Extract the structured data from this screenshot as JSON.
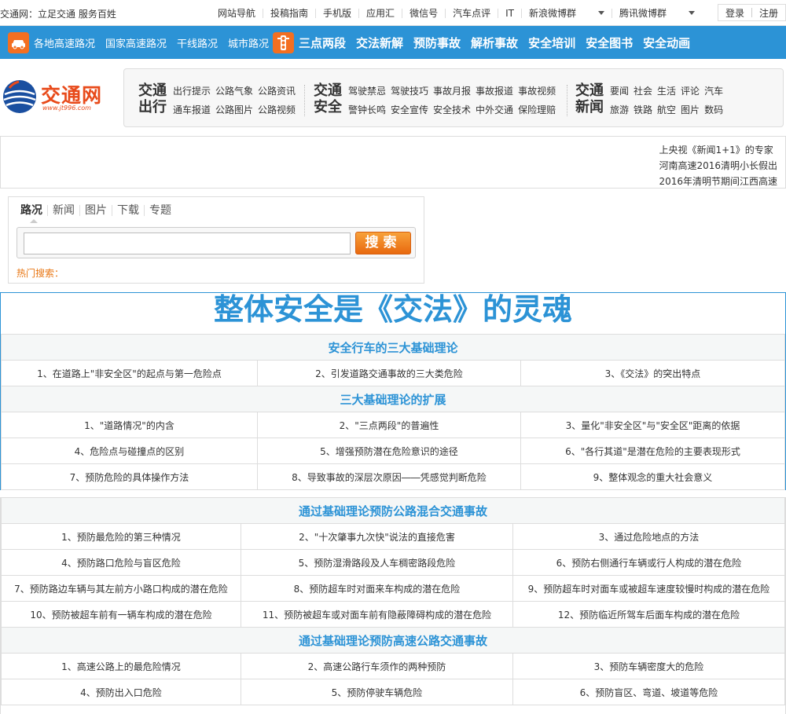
{
  "topbar": {
    "slogan": "交通网：立足交通 服务百姓",
    "links": [
      "网站导航",
      "投稿指南",
      "手机版",
      "应用汇",
      "微信号",
      "汽车点评",
      "IT"
    ],
    "weibo": [
      "新浪微博群",
      "腾讯微博群"
    ],
    "login": "登录",
    "register": "注册"
  },
  "bluenav": {
    "roads": [
      "各地高速路况",
      "国家高速路况",
      "干线路况",
      "城市路况"
    ],
    "menu": [
      "三点两段",
      "交法新解",
      "预防事故",
      "解析事故",
      "安全培训",
      "安全图书",
      "安全动画"
    ]
  },
  "logo": {
    "name": "交通网",
    "url": "www.jt996.com"
  },
  "categories": [
    {
      "title": "交通出行",
      "row1": [
        "出行提示",
        "公路气象",
        "公路资讯"
      ],
      "row2": [
        "通车报道",
        "公路图片",
        "公路视频"
      ]
    },
    {
      "title": "交通安全",
      "row1": [
        "驾驶禁忌",
        "驾驶技巧",
        "事故月报",
        "事故报道",
        "事故视频"
      ],
      "row2": [
        "警钟长鸣",
        "安全宣传",
        "安全技术",
        "中外交通",
        "保险理赔"
      ]
    },
    {
      "title": "交通新闻",
      "row1": [
        "要闻",
        "社会",
        "生活",
        "评论",
        "汽车"
      ],
      "row2": [
        "旅游",
        "铁路",
        "航空",
        "图片",
        "数码"
      ]
    }
  ],
  "ticker": [
    "上央视《新闻1+1》的专家",
    "河南高速2016清明小长假出",
    "2016年清明节期间江西高速"
  ],
  "search": {
    "tabs": [
      "路况",
      "新闻",
      "图片",
      "下载",
      "专题"
    ],
    "placeholder": "",
    "button": "搜索",
    "hot_label": "热门搜索："
  },
  "main": {
    "title": "整体安全是《交法》的灵魂",
    "sections": [
      {
        "heading": "安全行车的三大基础理论",
        "items": [
          "1、在道路上\"非安全区\"的起点与第一危险点",
          "2、引发道路交通事故的三大类危险",
          "3、《交法》的突出特点"
        ]
      },
      {
        "heading": "三大基础理论的扩展",
        "items": [
          "1、\"道路情况\"的内含",
          "2、\"三点两段\"的普遍性",
          "3、量化\"非安全区\"与\"安全区\"距离的依据",
          "4、危险点与碰撞点的区别",
          "5、增强预防潜在危险意识的途径",
          "6、\"各行其道\"是潜在危险的主要表现形式",
          "7、预防危险的具体操作方法",
          "8、导致事故的深层次原因――凭感觉判断危险",
          "9、整体观念的重大社会意义"
        ]
      }
    ],
    "sections2": [
      {
        "heading": "通过基础理论预防公路混合交通事故",
        "items": [
          "1、预防最危险的第三种情况",
          "2、\"十次肇事九次快\"说法的直接危害",
          "3、通过危险地点的方法",
          "4、预防路口危险与盲区危险",
          "5、预防湿滑路段及人车稠密路段危险",
          "6、预防右侧通行车辆或行人构成的潜在危险",
          "7、预防路边车辆与其左前方小路口构成的潜在危险",
          "8、预防超车时对面来车构成的潜在危险",
          "9、预防超车时对面车或被超车速度较慢时构成的潜在危险",
          "10、预防被超车前有一辆车构成的潜在危险",
          "11、预防被超车或对面车前有隐蔽障碍构成的潜在危险",
          "12、预防临近所驾车后面车构成的潜在危险"
        ]
      },
      {
        "heading": "通过基础理论预防高速公路交通事故",
        "items": [
          "1、高速公路上的最危险情况",
          "2、高速公路行车须作的两种预防",
          "3、预防车辆密度大的危险",
          "4、预防出入口危险",
          "5、预防停驶车辆危险",
          "6、预防盲区、弯道、坡道等危险"
        ]
      }
    ]
  },
  "colors": {
    "brand_blue": "#2c93d6",
    "accent_orange": "#f36f21",
    "logo_red": "#e84a1a"
  }
}
